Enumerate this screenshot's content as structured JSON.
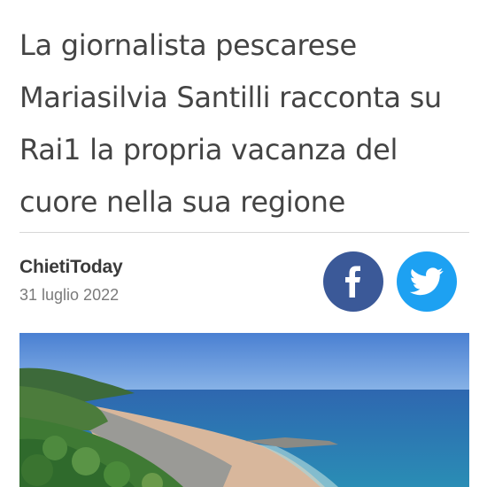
{
  "article": {
    "headline_lines": [
      "La giornalista pescarese",
      "Mariasilvia Santilli racconta su",
      "Rai1 la propria vacanza del",
      "cuore nella sua regione"
    ],
    "source": "ChietiToday",
    "date": "31 luglio 2022"
  },
  "share": {
    "facebook": {
      "icon": "facebook-icon",
      "color": "#3b5998"
    },
    "twitter": {
      "icon": "twitter-icon",
      "color": "#1da1f2"
    }
  },
  "photo": {
    "subject": "coastal-beach-photo",
    "colors": {
      "sky": "#4f86d6",
      "sea": "#2f6fb8",
      "vegetation": "#3f7a34",
      "sand": "#d8b79c"
    }
  }
}
